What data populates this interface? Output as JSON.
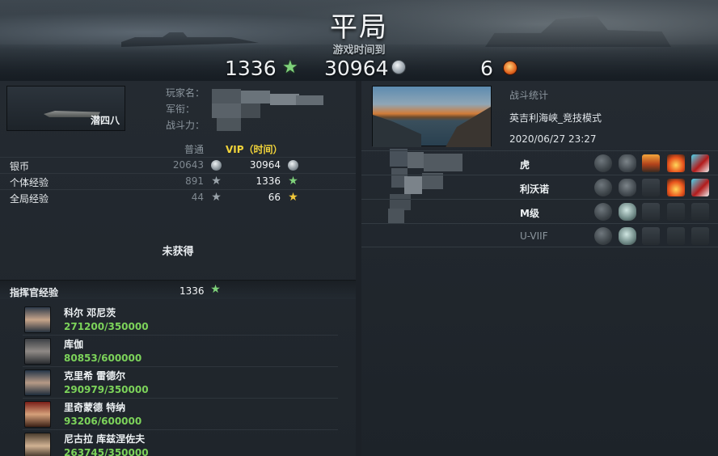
{
  "header": {
    "title": "平局",
    "subtitle": "游戏时间到",
    "xp_reward": "1336",
    "silver_reward": "30964",
    "medals": "6"
  },
  "player": {
    "ship_name": "潜四八",
    "label_name": "玩家名：",
    "label_rank": "军衔：",
    "label_power": "战斗力："
  },
  "currency": {
    "col_normal": "普通",
    "col_vip": "VIP（时间）",
    "rows": [
      {
        "label": "银币",
        "normal": "20643",
        "vip": "30964",
        "icon": "silver-icon"
      },
      {
        "label": "个体经验",
        "normal": "891",
        "vip": "1336",
        "icon": "star-icon"
      },
      {
        "label": "全局经验",
        "normal": "44",
        "vip": "66",
        "icon": "star-icon"
      }
    ]
  },
  "not_obtained": "未获得",
  "commander": {
    "label": "指挥官经验",
    "value": "1336",
    "list": [
      {
        "name": "科尔 邓尼茨",
        "xp": "271200/350000"
      },
      {
        "name": "库伽",
        "xp": "80853/600000"
      },
      {
        "name": "克里希 雷德尔",
        "xp": "290979/350000"
      },
      {
        "name": "里奇蒙德 特纳",
        "xp": "93206/600000"
      },
      {
        "name": "尼古拉 库兹涅佐夫",
        "xp": "263745/350000"
      }
    ]
  },
  "battle": {
    "stats_label": "战斗统计",
    "map_name": "英吉利海峡_竞技模式",
    "time": "2020/06/27 23:27",
    "ships": [
      {
        "name": "虎",
        "dim": false
      },
      {
        "name": "利沃诺",
        "dim": false
      },
      {
        "name": "M级",
        "dim": false
      },
      {
        "name": "U-VIIF",
        "dim": true
      }
    ]
  },
  "colors": {
    "xp_green": "#7cd35a",
    "vip_yellow": "#f2d43a",
    "panel_bg": "#242a31"
  }
}
